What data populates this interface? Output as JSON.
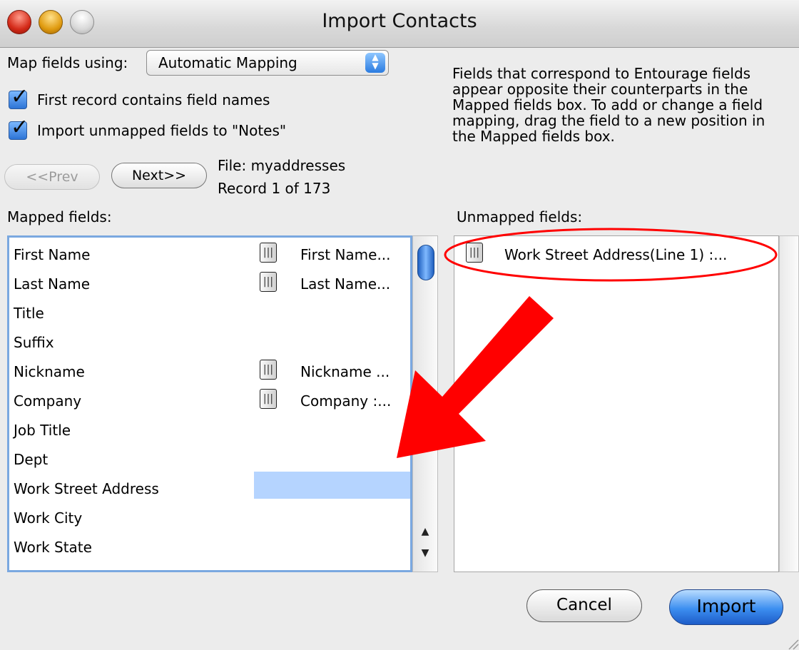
{
  "window": {
    "title": "Import Contacts"
  },
  "mapping": {
    "label": "Map fields using:",
    "selected": "Automatic Mapping",
    "first_record_label": "First record contains field names",
    "first_record_checked": true,
    "import_unmapped_label": "Import unmapped fields to \"Notes\"",
    "import_unmapped_checked": true
  },
  "navigation": {
    "prev_label": "<<Prev",
    "next_label": "Next>>",
    "file_text": "File: myaddresses",
    "record_text": "Record 1 of 173"
  },
  "description": "Fields that correspond to Entourage fields appear opposite their counterparts in the Mapped fields box. To add or change a field mapping, drag the field to a new position in the Mapped fields box.",
  "mapped": {
    "heading": "Mapped fields:",
    "rows": [
      {
        "name": "First Name",
        "value": "First Name...",
        "has_icon": true
      },
      {
        "name": "Last Name",
        "value": "Last Name...",
        "has_icon": true
      },
      {
        "name": "Title",
        "value": "",
        "has_icon": false
      },
      {
        "name": "Suffix",
        "value": "",
        "has_icon": false
      },
      {
        "name": "Nickname",
        "value": "Nickname ...",
        "has_icon": true
      },
      {
        "name": "Company",
        "value": "Company :...",
        "has_icon": true
      },
      {
        "name": "Job Title",
        "value": "",
        "has_icon": false
      },
      {
        "name": "Dept",
        "value": "",
        "has_icon": false
      },
      {
        "name": "Work Street Address",
        "value": "",
        "has_icon": false,
        "highlighted": true
      },
      {
        "name": "Work City",
        "value": "",
        "has_icon": false
      },
      {
        "name": "Work State",
        "value": "",
        "has_icon": false
      }
    ]
  },
  "unmapped": {
    "heading": "Unmapped fields:",
    "items": [
      {
        "value": "Work Street Address(Line 1) :..."
      }
    ]
  },
  "buttons": {
    "cancel_label": "Cancel",
    "import_label": "Import"
  },
  "annotation": {
    "color": "#ff0000"
  }
}
